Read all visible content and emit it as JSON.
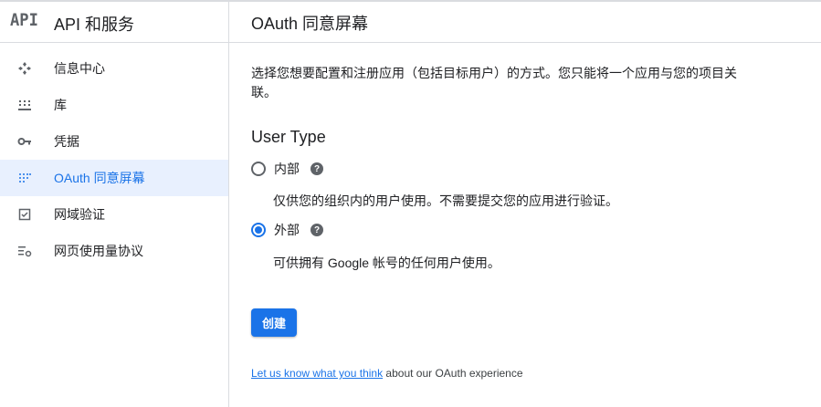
{
  "sidebar": {
    "logo": "API",
    "title": "API 和服务",
    "items": [
      {
        "label": "信息中心",
        "icon": "dashboard-icon",
        "active": false
      },
      {
        "label": "库",
        "icon": "library-icon",
        "active": false
      },
      {
        "label": "凭据",
        "icon": "key-icon",
        "active": false
      },
      {
        "label": "OAuth 同意屏幕",
        "icon": "consent-icon",
        "active": true
      },
      {
        "label": "网域验证",
        "icon": "checkbox-icon",
        "active": false
      },
      {
        "label": "网页使用量协议",
        "icon": "settings-list-icon",
        "active": false
      }
    ]
  },
  "main": {
    "title": "OAuth 同意屏幕",
    "description": "选择您想要配置和注册应用（包括目标用户）的方式。您只能将一个应用与您的项目关联。",
    "user_type_title": "User Type",
    "options": [
      {
        "label": "内部",
        "description": "仅供您的组织内的用户使用。不需要提交您的应用进行验证。",
        "checked": false
      },
      {
        "label": "外部",
        "description": "可供拥有 Google 帐号的任何用户使用。",
        "checked": true
      }
    ],
    "create_label": "创建",
    "feedback_link": "Let us know what you think",
    "feedback_text": " about our OAuth experience"
  },
  "colors": {
    "accent": "#1a73e8",
    "active_bg": "#e8f0fe",
    "border": "#dadce0",
    "icon": "#5f6368"
  }
}
